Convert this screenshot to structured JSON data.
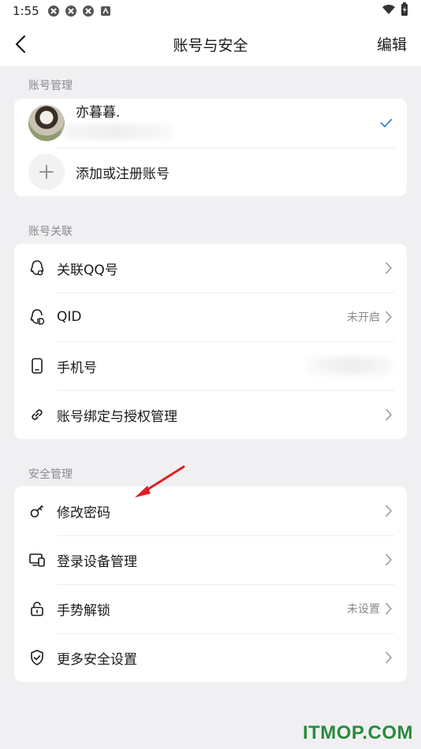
{
  "status_bar": {
    "time": "1:55"
  },
  "nav": {
    "title": "账号与安全",
    "edit": "编辑"
  },
  "account_section": {
    "label": "账号管理",
    "current_account": {
      "name": "亦暮暮."
    },
    "add_account": "添加或注册账号"
  },
  "binding_section": {
    "label": "账号关联",
    "items": [
      {
        "label": "关联QQ号",
        "status": ""
      },
      {
        "label": "QID",
        "status": "未开启"
      },
      {
        "label": "手机号",
        "status": ""
      },
      {
        "label": "账号绑定与授权管理",
        "status": ""
      }
    ]
  },
  "security_section": {
    "label": "安全管理",
    "items": [
      {
        "label": "修改密码",
        "status": ""
      },
      {
        "label": "登录设备管理",
        "status": ""
      },
      {
        "label": "手势解锁",
        "status": "未设置"
      },
      {
        "label": "更多安全设置",
        "status": ""
      }
    ]
  },
  "watermark": "ITMOP.COM",
  "colors": {
    "accent": "#2a86f0",
    "annotation_arrow": "#e02020",
    "watermark": "#2b8a3e"
  }
}
